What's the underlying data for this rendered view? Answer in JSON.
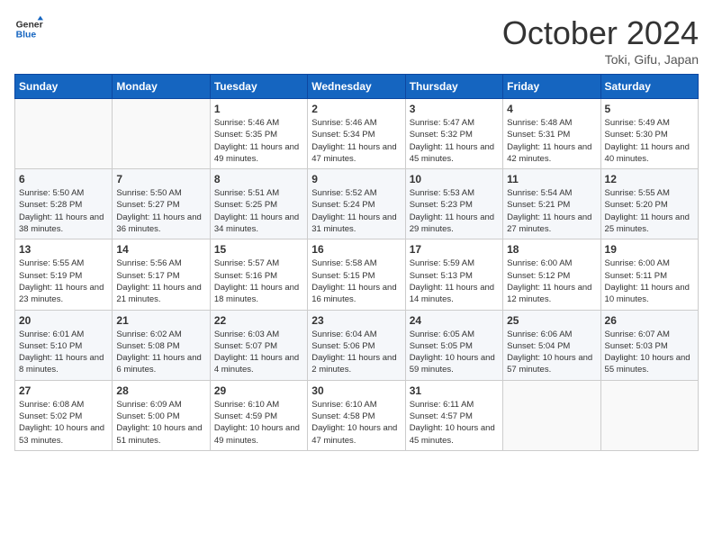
{
  "header": {
    "logo_line1": "General",
    "logo_line2": "Blue",
    "month": "October 2024",
    "location": "Toki, Gifu, Japan"
  },
  "weekdays": [
    "Sunday",
    "Monday",
    "Tuesday",
    "Wednesday",
    "Thursday",
    "Friday",
    "Saturday"
  ],
  "weeks": [
    [
      {
        "day": "",
        "info": ""
      },
      {
        "day": "",
        "info": ""
      },
      {
        "day": "1",
        "info": "Sunrise: 5:46 AM\nSunset: 5:35 PM\nDaylight: 11 hours and 49 minutes."
      },
      {
        "day": "2",
        "info": "Sunrise: 5:46 AM\nSunset: 5:34 PM\nDaylight: 11 hours and 47 minutes."
      },
      {
        "day": "3",
        "info": "Sunrise: 5:47 AM\nSunset: 5:32 PM\nDaylight: 11 hours and 45 minutes."
      },
      {
        "day": "4",
        "info": "Sunrise: 5:48 AM\nSunset: 5:31 PM\nDaylight: 11 hours and 42 minutes."
      },
      {
        "day": "5",
        "info": "Sunrise: 5:49 AM\nSunset: 5:30 PM\nDaylight: 11 hours and 40 minutes."
      }
    ],
    [
      {
        "day": "6",
        "info": "Sunrise: 5:50 AM\nSunset: 5:28 PM\nDaylight: 11 hours and 38 minutes."
      },
      {
        "day": "7",
        "info": "Sunrise: 5:50 AM\nSunset: 5:27 PM\nDaylight: 11 hours and 36 minutes."
      },
      {
        "day": "8",
        "info": "Sunrise: 5:51 AM\nSunset: 5:25 PM\nDaylight: 11 hours and 34 minutes."
      },
      {
        "day": "9",
        "info": "Sunrise: 5:52 AM\nSunset: 5:24 PM\nDaylight: 11 hours and 31 minutes."
      },
      {
        "day": "10",
        "info": "Sunrise: 5:53 AM\nSunset: 5:23 PM\nDaylight: 11 hours and 29 minutes."
      },
      {
        "day": "11",
        "info": "Sunrise: 5:54 AM\nSunset: 5:21 PM\nDaylight: 11 hours and 27 minutes."
      },
      {
        "day": "12",
        "info": "Sunrise: 5:55 AM\nSunset: 5:20 PM\nDaylight: 11 hours and 25 minutes."
      }
    ],
    [
      {
        "day": "13",
        "info": "Sunrise: 5:55 AM\nSunset: 5:19 PM\nDaylight: 11 hours and 23 minutes."
      },
      {
        "day": "14",
        "info": "Sunrise: 5:56 AM\nSunset: 5:17 PM\nDaylight: 11 hours and 21 minutes."
      },
      {
        "day": "15",
        "info": "Sunrise: 5:57 AM\nSunset: 5:16 PM\nDaylight: 11 hours and 18 minutes."
      },
      {
        "day": "16",
        "info": "Sunrise: 5:58 AM\nSunset: 5:15 PM\nDaylight: 11 hours and 16 minutes."
      },
      {
        "day": "17",
        "info": "Sunrise: 5:59 AM\nSunset: 5:13 PM\nDaylight: 11 hours and 14 minutes."
      },
      {
        "day": "18",
        "info": "Sunrise: 6:00 AM\nSunset: 5:12 PM\nDaylight: 11 hours and 12 minutes."
      },
      {
        "day": "19",
        "info": "Sunrise: 6:00 AM\nSunset: 5:11 PM\nDaylight: 11 hours and 10 minutes."
      }
    ],
    [
      {
        "day": "20",
        "info": "Sunrise: 6:01 AM\nSunset: 5:10 PM\nDaylight: 11 hours and 8 minutes."
      },
      {
        "day": "21",
        "info": "Sunrise: 6:02 AM\nSunset: 5:08 PM\nDaylight: 11 hours and 6 minutes."
      },
      {
        "day": "22",
        "info": "Sunrise: 6:03 AM\nSunset: 5:07 PM\nDaylight: 11 hours and 4 minutes."
      },
      {
        "day": "23",
        "info": "Sunrise: 6:04 AM\nSunset: 5:06 PM\nDaylight: 11 hours and 2 minutes."
      },
      {
        "day": "24",
        "info": "Sunrise: 6:05 AM\nSunset: 5:05 PM\nDaylight: 10 hours and 59 minutes."
      },
      {
        "day": "25",
        "info": "Sunrise: 6:06 AM\nSunset: 5:04 PM\nDaylight: 10 hours and 57 minutes."
      },
      {
        "day": "26",
        "info": "Sunrise: 6:07 AM\nSunset: 5:03 PM\nDaylight: 10 hours and 55 minutes."
      }
    ],
    [
      {
        "day": "27",
        "info": "Sunrise: 6:08 AM\nSunset: 5:02 PM\nDaylight: 10 hours and 53 minutes."
      },
      {
        "day": "28",
        "info": "Sunrise: 6:09 AM\nSunset: 5:00 PM\nDaylight: 10 hours and 51 minutes."
      },
      {
        "day": "29",
        "info": "Sunrise: 6:10 AM\nSunset: 4:59 PM\nDaylight: 10 hours and 49 minutes."
      },
      {
        "day": "30",
        "info": "Sunrise: 6:10 AM\nSunset: 4:58 PM\nDaylight: 10 hours and 47 minutes."
      },
      {
        "day": "31",
        "info": "Sunrise: 6:11 AM\nSunset: 4:57 PM\nDaylight: 10 hours and 45 minutes."
      },
      {
        "day": "",
        "info": ""
      },
      {
        "day": "",
        "info": ""
      }
    ]
  ]
}
